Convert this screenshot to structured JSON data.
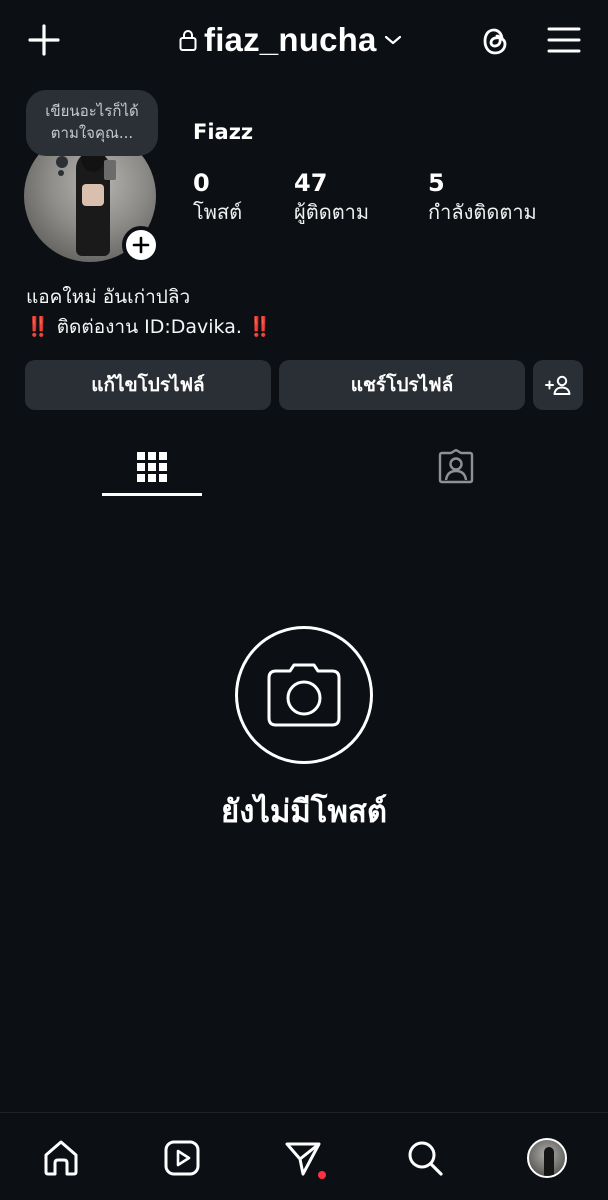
{
  "header": {
    "username": "fiaz_nucha"
  },
  "note": {
    "text_line1": "เขียนอะไรก็ได้",
    "text_line2": "ตามใจคุณ..."
  },
  "profile": {
    "display_name": "Fiazz",
    "stats": [
      {
        "value": "0",
        "label": "โพสต์"
      },
      {
        "value": "47",
        "label": "ผู้ติดตาม"
      },
      {
        "value": "5",
        "label": "กำลังติดตาม"
      }
    ],
    "bio_line1": "แอคใหม่ อันเก่าปลิว",
    "bio_line2_prefix": "‼️",
    "bio_line2_text": "ติดต่องาน ID:Davika.",
    "bio_line2_suffix": "‼️"
  },
  "actions": {
    "edit_profile": "แก้ไขโปรไฟล์",
    "share_profile": "แชร์โปรไฟล์"
  },
  "tabs": [
    {
      "name": "posts-grid",
      "icon": "grid-icon",
      "active": true
    },
    {
      "name": "tagged",
      "icon": "tagged-person-icon",
      "active": false
    }
  ],
  "empty_state": {
    "title": "ยังไม่มีโพสต์",
    "icon": "camera-icon"
  },
  "bottom_nav": [
    {
      "icon": "home-icon"
    },
    {
      "icon": "reels-icon"
    },
    {
      "icon": "direct-send-icon",
      "badge": true
    },
    {
      "icon": "search-icon"
    },
    {
      "icon": "profile-avatar"
    }
  ],
  "colors": {
    "background": "#0c1014",
    "button_bg": "#2a2f35",
    "badge_red": "#ff3040",
    "alert_red": "#e0245e"
  }
}
